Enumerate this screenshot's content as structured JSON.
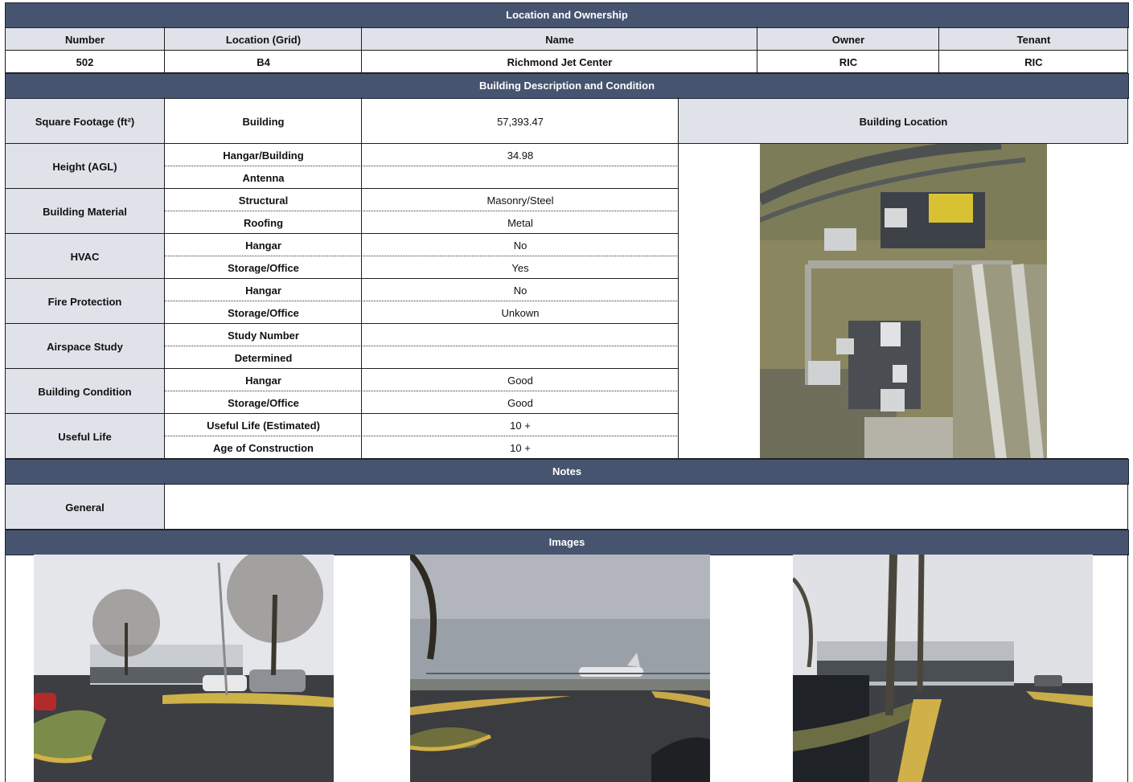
{
  "location_ownership": {
    "title": "Location and Ownership",
    "headers": [
      "Number",
      "Location (Grid)",
      "Name",
      "Owner",
      "Tenant"
    ],
    "values": [
      "502",
      "B4",
      "Richmond Jet Center",
      "RIC",
      "RIC"
    ]
  },
  "building_description": {
    "title": "Building Description and Condition",
    "square_footage": {
      "label": "Square Footage (ft²)",
      "sub": "Building",
      "value": "57,393.47"
    },
    "building_location_label": "Building Location",
    "groups": [
      {
        "label": "Height (AGL)",
        "rows": [
          {
            "sub": "Hangar/Building",
            "value": "34.98"
          },
          {
            "sub": "Antenna",
            "value": ""
          }
        ]
      },
      {
        "label": "Building Material",
        "rows": [
          {
            "sub": "Structural",
            "value": "Masonry/Steel"
          },
          {
            "sub": "Roofing",
            "value": "Metal"
          }
        ]
      },
      {
        "label": "HVAC",
        "rows": [
          {
            "sub": "Hangar",
            "value": "No"
          },
          {
            "sub": "Storage/Office",
            "value": "Yes"
          }
        ]
      },
      {
        "label": "Fire Protection",
        "rows": [
          {
            "sub": "Hangar",
            "value": "No"
          },
          {
            "sub": "Storage/Office",
            "value": "Unkown"
          }
        ]
      },
      {
        "label": "Airspace Study",
        "rows": [
          {
            "sub": "Study Number",
            "value": ""
          },
          {
            "sub": "Determined",
            "value": ""
          }
        ]
      },
      {
        "label": "Building Condition",
        "rows": [
          {
            "sub": "Hangar",
            "value": "Good"
          },
          {
            "sub": "Storage/Office",
            "value": "Good"
          }
        ]
      },
      {
        "label": "Useful Life",
        "rows": [
          {
            "sub": "Useful Life (Estimated)",
            "value": "10 +"
          },
          {
            "sub": "Age of Construction",
            "value": "10 +"
          }
        ]
      }
    ]
  },
  "notes": {
    "title": "Notes",
    "general_label": "General",
    "general_value": ""
  },
  "images": {
    "title": "Images"
  }
}
